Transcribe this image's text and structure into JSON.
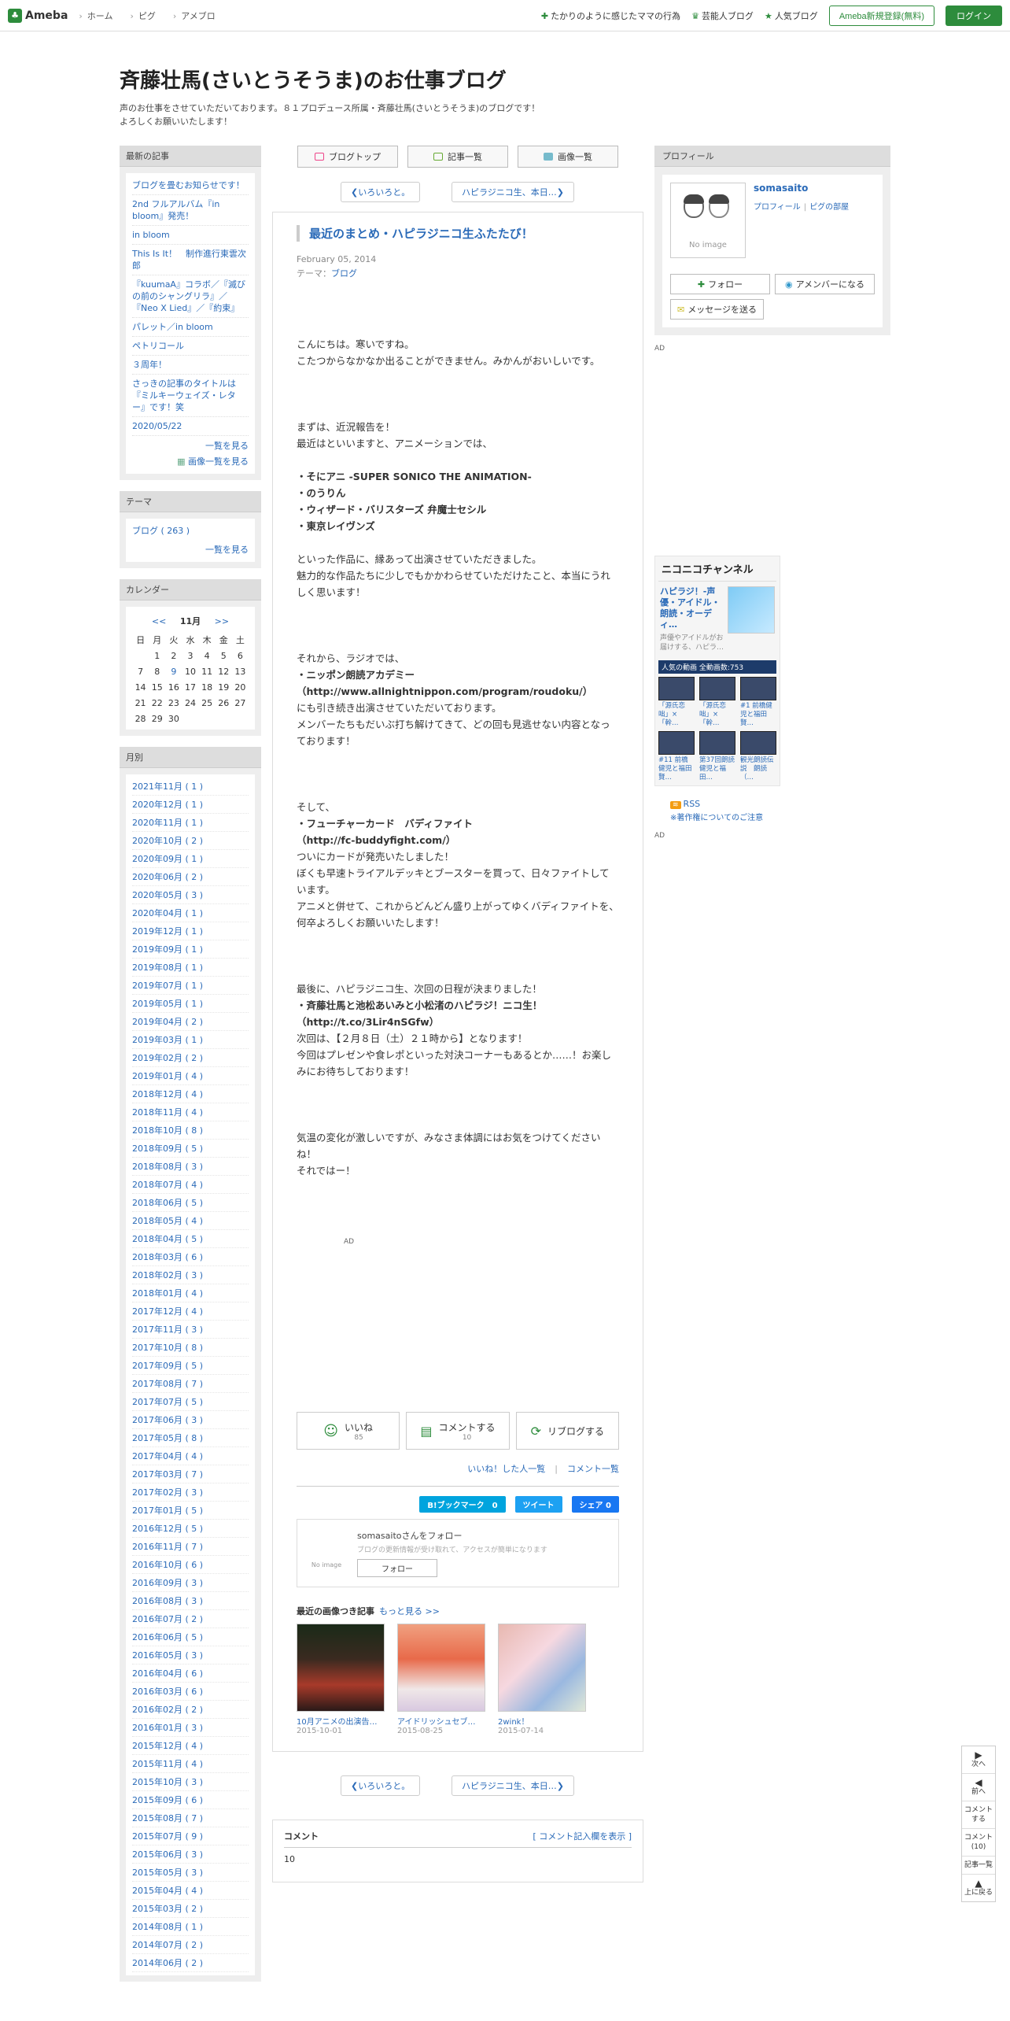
{
  "topbar": {
    "logo": "Ameba",
    "nav": [
      "ホーム",
      "ピグ",
      "アメブロ"
    ],
    "links": [
      "たかりのように感じたママの行為",
      "芸能人ブログ",
      "人気ブログ"
    ],
    "register": "Ameba新規登録(無料)",
    "login": "ログイン"
  },
  "blog": {
    "title": "斉藤壮馬(さいとうそうま)のお仕事ブログ",
    "desc1": "声のお仕事をさせていただいております。８１プロデュース所属・斉藤壮馬(さいとうそうま)のブログです！",
    "desc2": "よろしくお願いいたします！"
  },
  "sidebar": {
    "recent_head": "最新の記事",
    "recent": [
      "ブログを畳むお知らせです！",
      "2nd フルアルバム『in bloom』発売！",
      "in bloom",
      "This Is It！　制作進行東雲次郎",
      "『kuumaA』コラボ／『滅びの前のシャングリラ』／『Neo X Lied』／『約束』",
      "パレット／in bloom",
      "ペトリコール",
      "３周年！",
      "さっきの記事のタイトルは『ミルキーウェイズ・レター』です！笑",
      "2020/05/22"
    ],
    "recent_more": "一覧を見る",
    "img_more": "画像一覧を見る",
    "theme_head": "テーマ",
    "theme_item": "ブログ ( 263 )",
    "theme_more": "一覧を見る",
    "cal_head": "カレンダー",
    "cal_prev": "<<",
    "cal_month": "11月",
    "cal_next": ">>",
    "cal_days": [
      "日",
      "月",
      "火",
      "水",
      "木",
      "金",
      "土"
    ],
    "cal_weeks": [
      [
        "",
        "1",
        "2",
        "3",
        "4",
        "5",
        "6"
      ],
      [
        "7",
        "8",
        "9",
        "10",
        "11",
        "12",
        "13"
      ],
      [
        "14",
        "15",
        "16",
        "17",
        "18",
        "19",
        "20"
      ],
      [
        "21",
        "22",
        "23",
        "24",
        "25",
        "26",
        "27"
      ],
      [
        "28",
        "29",
        "30",
        "",
        "",
        "",
        ""
      ]
    ],
    "month_head": "月別",
    "months": [
      "2021年11月 ( 1 )",
      "2020年12月 ( 1 )",
      "2020年11月 ( 1 )",
      "2020年10月 ( 2 )",
      "2020年09月 ( 1 )",
      "2020年06月 ( 2 )",
      "2020年05月 ( 3 )",
      "2020年04月 ( 1 )",
      "2019年12月 ( 1 )",
      "2019年09月 ( 1 )",
      "2019年08月 ( 1 )",
      "2019年07月 ( 1 )",
      "2019年05月 ( 1 )",
      "2019年04月 ( 2 )",
      "2019年03月 ( 1 )",
      "2019年02月 ( 2 )",
      "2019年01月 ( 4 )",
      "2018年12月 ( 4 )",
      "2018年11月 ( 4 )",
      "2018年10月 ( 8 )",
      "2018年09月 ( 5 )",
      "2018年08月 ( 3 )",
      "2018年07月 ( 4 )",
      "2018年06月 ( 5 )",
      "2018年05月 ( 4 )",
      "2018年04月 ( 5 )",
      "2018年03月 ( 6 )",
      "2018年02月 ( 3 )",
      "2018年01月 ( 4 )",
      "2017年12月 ( 4 )",
      "2017年11月 ( 3 )",
      "2017年10月 ( 8 )",
      "2017年09月 ( 5 )",
      "2017年08月 ( 7 )",
      "2017年07月 ( 5 )",
      "2017年06月 ( 3 )",
      "2017年05月 ( 8 )",
      "2017年04月 ( 4 )",
      "2017年03月 ( 7 )",
      "2017年02月 ( 3 )",
      "2017年01月 ( 5 )",
      "2016年12月 ( 5 )",
      "2016年11月 ( 7 )",
      "2016年10月 ( 6 )",
      "2016年09月 ( 3 )",
      "2016年08月 ( 3 )",
      "2016年07月 ( 2 )",
      "2016年06月 ( 5 )",
      "2016年05月 ( 3 )",
      "2016年04月 ( 6 )",
      "2016年03月 ( 6 )",
      "2016年02月 ( 2 )",
      "2016年01月 ( 3 )",
      "2015年12月 ( 4 )",
      "2015年11月 ( 4 )",
      "2015年10月 ( 3 )",
      "2015年09月 ( 6 )",
      "2015年08月 ( 7 )",
      "2015年07月 ( 9 )",
      "2015年06月 ( 3 )",
      "2015年05月 ( 3 )",
      "2015年04月 ( 4 )",
      "2015年03月 ( 2 )",
      "2014年08月 ( 1 )",
      "2014年07月 ( 2 )",
      "2014年06月 ( 2 )"
    ]
  },
  "main": {
    "tabs": [
      "ブログトップ",
      "記事一覧",
      "画像一覧"
    ],
    "prev": "いろいろと。",
    "next": "ハピラジニコ生、本日…",
    "title": "最近のまとめ・ハピラジニコ生ふたたび！",
    "date": "February 05, 2014",
    "theme_label": "テーマ：",
    "theme": "ブログ",
    "body": {
      "l1": "こんにちは。寒いですね。",
      "l2": "こたつからなかなか出ることができません。みかんがおいしいです。",
      "l3": "まずは、近況報告を！",
      "l4": "最近はといいますと、アニメーションでは、",
      "b1": "・そにアニ -SUPER SONICO THE ANIMATION-",
      "b2": "・のうりん",
      "b3": "・ウィザード・バリスターズ 弁魔士セシル",
      "b4": "・東京レイヴンズ",
      "l5": "といった作品に、縁あって出演させていただきました。",
      "l6": "魅力的な作品たちに少しでもかかわらせていただけたこと、本当にうれしく思います！",
      "l7": "それから、ラジオでは、",
      "b5": "・ニッポン朗読アカデミー",
      "b6": "（http://www.allnightnippon.com/program/roudoku/）",
      "l8": "にも引き続き出演させていただいております。",
      "l9": "メンバーたちもだいぶ打ち解けてきて、どの回も見逃せない内容となっております！",
      "l10": "そして、",
      "b7": "・フューチャーカード　バディファイト",
      "b8": "（http://fc-buddyfight.com/）",
      "l11": "ついにカードが発売いたしました！",
      "l12": "ぼくも早速トライアルデッキとブースターを買って、日々ファイトしています。",
      "l13": "アニメと併せて、これからどんどん盛り上がってゆくバディファイトを、",
      "l14": "何卒よろしくお願いいたします！",
      "l15": "最後に、ハピラジニコ生、次回の日程が決まりました！",
      "b9": "・斉藤壮馬と池松あいみと小松渚のハピラジ！ニコ生！",
      "b10": "（http://t.co/3Lir4nSGfw）",
      "l16": "次回は、【２月８日（土）２１時から】となります！",
      "l17": "今回はプレゼンや食レポといった対決コーナーもあるとか……！お楽しみにお待ちしております！",
      "l18": "気温の変化が激しいですが、みなさま体調にはお気をつけてくださいね！",
      "l19": "それではー！"
    },
    "ad": "AD",
    "like": "いいね",
    "like_count": "85",
    "comment": "コメントする",
    "comment_count": "10",
    "reblog": "リブログする",
    "liked_users": "いいね！した人一覧",
    "comment_list": "コメント一覧",
    "share": [
      "B!ブックマーク　0",
      "ツイート",
      "シェア 0"
    ],
    "follow_name": "somasaitoさんをフォロー",
    "follow_note": "ブログの更新情報が受け取れて、アクセスが簡単になります",
    "follow_btn": "フォロー",
    "noimage": "No image",
    "recent_imgs": "最近の画像つき記事",
    "recent_imgs_more": "もっと見る >>",
    "thumbs": [
      {
        "title": "10月アニメの出演告…",
        "date": "2015-10-01"
      },
      {
        "title": "アイドリッシュセブ…",
        "date": "2015-08-25"
      },
      {
        "title": "2wink！",
        "date": "2015-07-14"
      }
    ],
    "comment_head": "コメント",
    "comment_toggle": "[ コメント記入欄を表示 ]",
    "comment_num": "10"
  },
  "right": {
    "prof_head": "プロフィール",
    "name": "somasaito",
    "link1": "プロフィール",
    "link2": "ピグの部屋",
    "noimage": "No image",
    "follow": "フォロー",
    "member": "アメンバーになる",
    "message": "メッセージを送る",
    "ad": "AD",
    "nico_logo": "ニコニコチャンネル",
    "nico_title": "ハピラジ！-声優・アイドル・朗読・オーディ…",
    "nico_sub": "声優やアイドルがお届けする、ハピラ…",
    "nico_bar": "人気の動画 全動画数:753",
    "nico_videos": [
      "「源氏恋咄」×「幹…",
      "「源氏恋咄」×「幹…",
      "#1 前橋健児と福田賢…",
      "#11 前橋健児と福田賢…",
      "第37回朗読健児と福田…",
      "観光朗読伝説　朗読（…"
    ],
    "rss": "RSS",
    "rss_note": "※著作権についてのご注意",
    "ad2": "AD"
  },
  "floatnav": {
    "next": "次へ",
    "prev": "前へ",
    "comment": "コメントする",
    "comments": "コメント(10)",
    "list": "記事一覧",
    "top": "上に戻る"
  }
}
